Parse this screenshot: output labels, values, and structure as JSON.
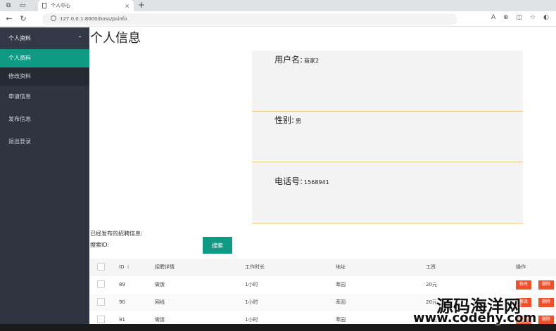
{
  "browser": {
    "tab_title": "个人中心",
    "url": "127.0.0.1:8000/boss/psinfo",
    "new_tab_icon": "+",
    "close_icon": "×"
  },
  "sidebar": {
    "header": "个人资料",
    "items": [
      {
        "label": "个人资料"
      },
      {
        "label": "修改资料"
      },
      {
        "label": "申请信息"
      },
      {
        "label": "发布信息"
      },
      {
        "label": "退出登录"
      }
    ]
  },
  "main": {
    "title": "个人信息",
    "fields": [
      {
        "label": "用户名:",
        "value": "商家2"
      },
      {
        "label": "性别:",
        "value": "男"
      },
      {
        "label": "电话号:",
        "value": "1568941"
      }
    ],
    "published_label": "已经发布的招聘信息:",
    "search_label": "搜索ID:",
    "search_button": "搜索"
  },
  "table": {
    "columns": [
      "ID",
      "招聘详情",
      "工作时长",
      "地址",
      "工资",
      "操作"
    ],
    "rows": [
      {
        "id": "89",
        "detail": "做饭",
        "hours": "1小时",
        "addr": "萃园",
        "pay": "20元"
      },
      {
        "id": "90",
        "detail": "网线",
        "hours": "1小时",
        "addr": "萃园",
        "pay": "20元"
      },
      {
        "id": "91",
        "detail": "做饭",
        "hours": "1小时",
        "addr": "萃园",
        "pay": "20元"
      }
    ],
    "edit_label": "修改",
    "delete_label": "删除"
  },
  "watermark": {
    "line1": "源码海洋网",
    "line2": "www.codehy.com"
  },
  "colors": {
    "sidebar_bg": "#2f3441",
    "accent": "#0f9a86",
    "danger": "#f04f2a",
    "card_border": "#e9cf8a"
  }
}
